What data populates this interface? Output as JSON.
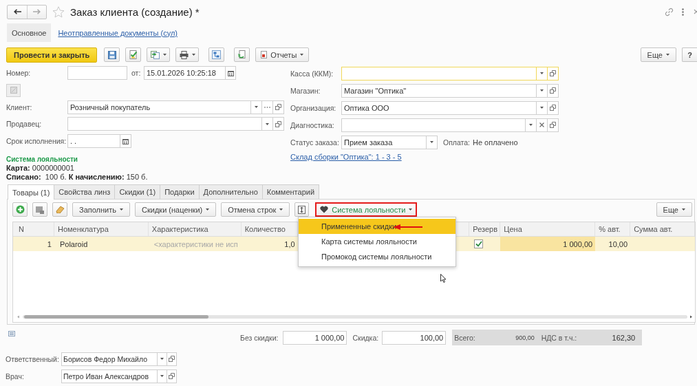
{
  "title": "Заказ клиента (создание) *",
  "sections": [
    {
      "label": "Основное",
      "selected": true
    },
    {
      "label": "Неотправленные документы (сул)",
      "selected": false
    }
  ],
  "toolbar": {
    "post_and_close": "Провести и закрыть",
    "reports": "Отчеты",
    "more": "Еще",
    "help": "?"
  },
  "form": {
    "number": {
      "label": "Номер:"
    },
    "date": {
      "label": "от:",
      "value": "15.01.2026 10:25:18"
    },
    "client": {
      "label": "Клиент:",
      "value": "Розничный покупатель"
    },
    "seller": {
      "label": "Продавец:"
    },
    "due_date": {
      "label": "Срок исполнения:",
      "value": ". ."
    },
    "cash_register": {
      "label": "Касса (ККМ):",
      "focused": true
    },
    "store": {
      "label": "Магазин:",
      "value": "Магазин \"Оптика\""
    },
    "organization": {
      "label": "Организация:",
      "value": "Оптика ООО"
    },
    "diagnostics": {
      "label": "Диагностика:"
    },
    "order_status": {
      "label": "Статус заказа:",
      "value": "Прием заказа"
    },
    "payment": {
      "label": "Оплата:",
      "value": "Не оплачено"
    },
    "warehouse_link": "Склад сборки \"Оптика\": 1 - 3 - 5"
  },
  "loyalty": {
    "title": "Система лояльности",
    "card": "**Карта:** 0000000001",
    "balance": "**Списано:**  100 б. **К начислению:** 150 б."
  },
  "tabs": [
    {
      "label": "Товары (1)",
      "selected": true
    },
    {
      "label": "Свойства линз",
      "selected": false
    },
    {
      "label": "Скидки (1)",
      "selected": false
    },
    {
      "label": "Подарки",
      "selected": false
    },
    {
      "label": "Дополнительно",
      "selected": false
    },
    {
      "label": "Комментарий",
      "selected": false
    }
  ],
  "table_toolbar": {
    "fill": "Заполнить",
    "discounts": "Скидки (наценки)",
    "cancel_rows": "Отмена строк",
    "loyalty": "Система лояльности",
    "more": "Еще"
  },
  "loyalty_menu": [
    {
      "label": "Примененные скидки",
      "selected": true
    },
    {
      "label": "Карта системы лояльности",
      "selected": false
    },
    {
      "label": "Промокод системы лояльности",
      "selected": false
    }
  ],
  "table": {
    "columns": [
      "N",
      "Номенклатура",
      "Характеристика",
      "Количество",
      "Резерв",
      "Цена",
      "% авт.",
      "Сумма авт."
    ],
    "rows": [
      {
        "cells": [
          "1",
          "Polaroid",
          "<характеристики не исп",
          "1,0",
          "1 000,00",
          "10,00"
        ],
        "reserve": true,
        "selected": true
      }
    ]
  },
  "totals": {
    "without_discount_label": "Без скидки:",
    "without_discount": "1 000,00",
    "discount_label": "Скидка:",
    "discount": "100,00",
    "total_label": "Всего:",
    "total": "900,00",
    "vat_label": "НДС в т.ч.:",
    "vat": "162,30"
  },
  "responsible": {
    "label": "Ответственный:",
    "value": "Борисов Федор Михайло"
  },
  "doctor": {
    "label": "Врач:",
    "value": "Петро Иван Александров"
  }
}
